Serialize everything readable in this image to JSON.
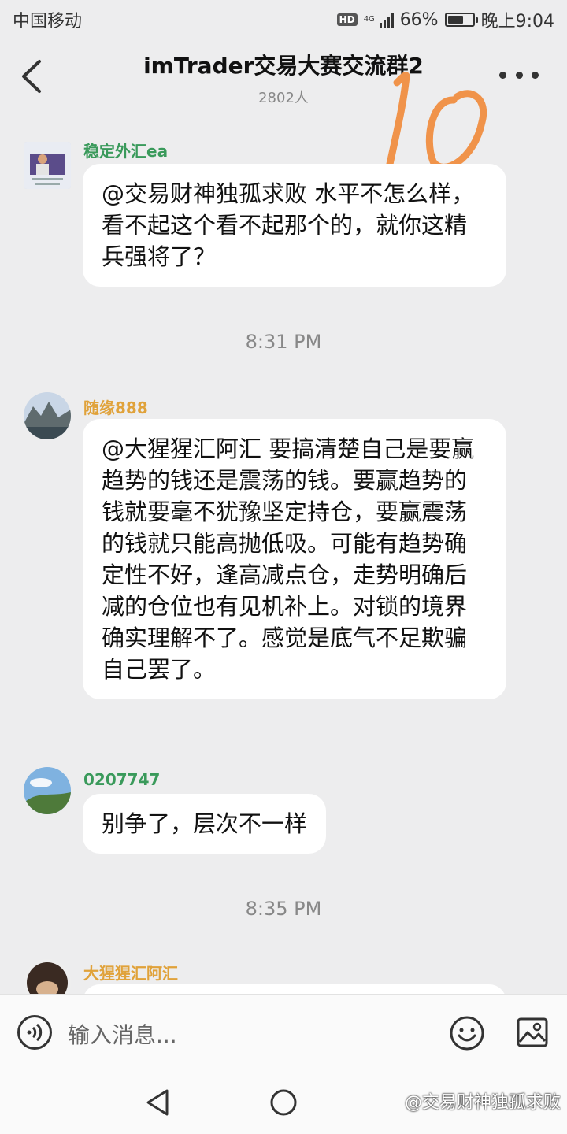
{
  "status_bar": {
    "carrier": "中国移动",
    "hd": "HD",
    "network": "4G",
    "battery": "66%",
    "battery_level": 0.66,
    "time": "晚上9:04"
  },
  "header": {
    "title": "imTrader交易大赛交流群2",
    "member_count": "2802人",
    "back_icon": "chevron-left-icon",
    "more_icon": "more-dots-icon"
  },
  "annotation": {
    "handwritten": "10",
    "color": "#f0934a"
  },
  "messages": [
    {
      "sender": "稳定外汇ea",
      "sender_color": "#3a9a5b",
      "text": "@交易财神独孤求败 水平不怎么样，看不起这个看不起那个的，就你这精兵强将了？"
    },
    {
      "sender": "随缘888",
      "sender_color": "#e0a23a",
      "text": "@大猩猩汇阿汇 要搞清楚自己是要赢趋势的钱还是震荡的钱。要赢趋势的钱就要毫不犹豫坚定持仓，要赢震荡的钱就只能高抛低吸。可能有趋势确定性不好，逢高减点仓，走势明确后减的仓位也有见机补上。对锁的境界确实理解不了。感觉是底气不足欺骗自己罢了。"
    },
    {
      "sender": "0207747",
      "sender_color": "#3a9a5b",
      "text": "别争了，层次不一样"
    },
    {
      "sender": "大猩猩汇阿汇",
      "sender_color": "#e0a23a",
      "text": ""
    }
  ],
  "timestamps": [
    "8:31 PM",
    "8:35 PM"
  ],
  "input": {
    "placeholder": "输入消息..."
  },
  "watermark": "@交易财神独孤求败"
}
